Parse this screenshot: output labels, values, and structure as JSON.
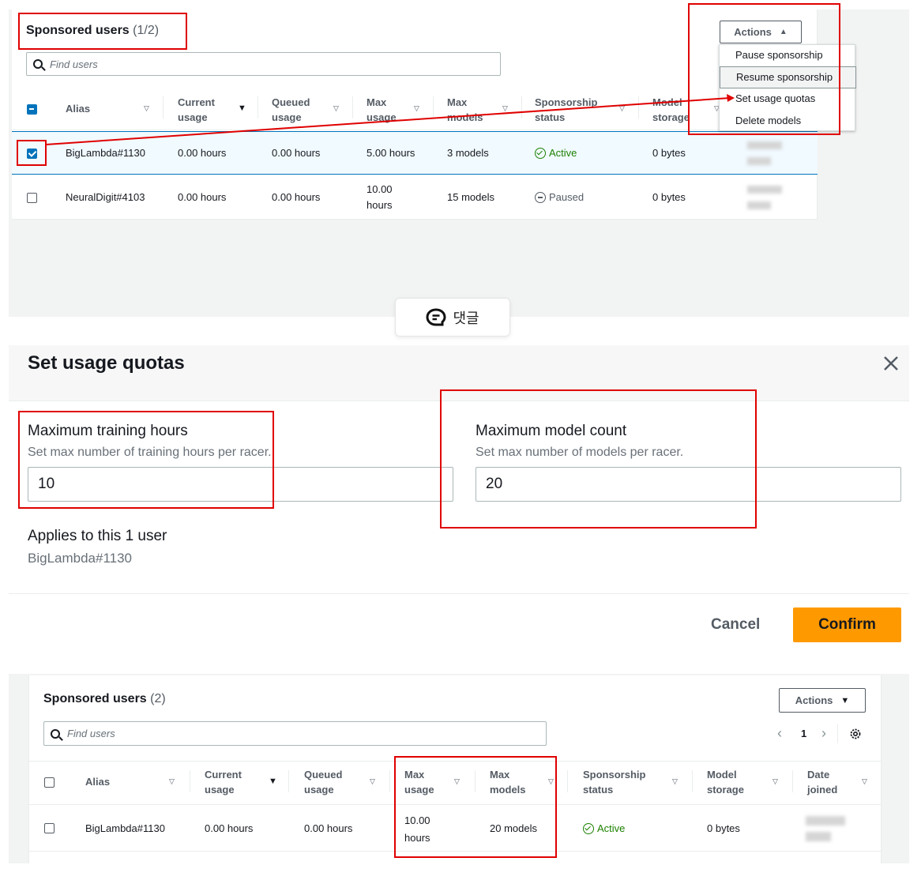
{
  "top": {
    "title": "Sponsored users",
    "count": "(1/2)",
    "search_placeholder": "Find users",
    "actions_label": "Actions",
    "menu": [
      "Pause sponsorship",
      "Resume sponsorship",
      "Set usage quotas",
      "Delete models"
    ],
    "headers": {
      "alias": "Alias",
      "current": [
        "Current",
        "usage"
      ],
      "queued": [
        "Queued",
        "usage"
      ],
      "max_usage": [
        "Max",
        "usage"
      ],
      "max_models": [
        "Max",
        "models"
      ],
      "status": [
        "Sponsorship",
        "status"
      ],
      "storage": [
        "Model",
        "storage"
      ]
    },
    "rows": [
      {
        "alias": "BigLambda#1130",
        "current": "0.00 hours",
        "queued": "0.00 hours",
        "max_usage": "5.00 hours",
        "max_models": "3 models",
        "status": "Active",
        "storage": "0 bytes"
      },
      {
        "alias": "NeuralDigit#4103",
        "current": "0.00 hours",
        "queued": "0.00 hours",
        "max_usage_1": "10.00",
        "max_usage_2": "hours",
        "max_models": "15 models",
        "status": "Paused",
        "storage": "0 bytes"
      }
    ]
  },
  "comment": {
    "label": "댓글"
  },
  "modal": {
    "title": "Set usage quotas",
    "hours_label": "Maximum training hours",
    "hours_desc": "Set max number of training hours per racer.",
    "hours_value": "10",
    "models_label": "Maximum model count",
    "models_desc": "Set max number of models per racer.",
    "models_value": "20",
    "applies_label": "Applies to this 1 user",
    "applies_user": "BigLambda#1130",
    "cancel": "Cancel",
    "confirm": "Confirm"
  },
  "bottom": {
    "title": "Sponsored users",
    "count": "(2)",
    "search_placeholder": "Find users",
    "actions_label": "Actions",
    "page": "1",
    "headers": {
      "alias": "Alias",
      "current": [
        "Current",
        "usage"
      ],
      "queued": [
        "Queued",
        "usage"
      ],
      "max_usage": [
        "Max",
        "usage"
      ],
      "max_models": [
        "Max",
        "models"
      ],
      "status": [
        "Sponsorship",
        "status"
      ],
      "storage": [
        "Model",
        "storage"
      ],
      "date": [
        "Date",
        "joined"
      ]
    },
    "row": {
      "alias": "BigLambda#1130",
      "current": "0.00 hours",
      "queued": "0.00 hours",
      "max_usage_1": "10.00",
      "max_usage_2": "hours",
      "max_models": "20 models",
      "status": "Active",
      "storage": "0 bytes"
    }
  },
  "colors": {
    "accent": "#0073bb",
    "active": "#1d8102",
    "paused": "#545b64",
    "confirm": "#ff9900",
    "highlight": "#e00000"
  }
}
